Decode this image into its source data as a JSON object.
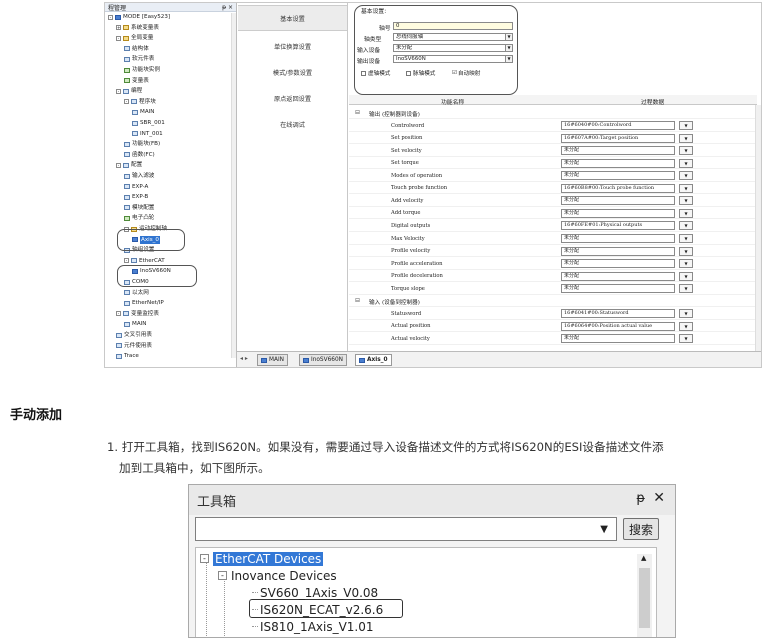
{
  "project": {
    "panel_title": "程管理",
    "panel_pin": "ᵽ ×",
    "tree": [
      {
        "label": "MODE [Easy523]",
        "depth": 0,
        "pm": "-",
        "icon": "b"
      },
      {
        "label": "系统变量表",
        "depth": 1,
        "pm": "+",
        "icon": "y"
      },
      {
        "label": "全局变量",
        "depth": 1,
        "pm": "-",
        "icon": "y"
      },
      {
        "label": "结构体",
        "depth": 2,
        "pm": "",
        "icon": ""
      },
      {
        "label": "软元件表",
        "depth": 2,
        "pm": "",
        "icon": ""
      },
      {
        "label": "功能块实例",
        "depth": 2,
        "pm": "",
        "icon": "g"
      },
      {
        "label": "变量表",
        "depth": 2,
        "pm": "",
        "icon": "g"
      },
      {
        "label": "编程",
        "depth": 1,
        "pm": "-",
        "icon": ""
      },
      {
        "label": "程序块",
        "depth": 2,
        "pm": "-",
        "icon": ""
      },
      {
        "label": "MAIN",
        "depth": 3,
        "pm": "",
        "icon": ""
      },
      {
        "label": "SBR_001",
        "depth": 3,
        "pm": "",
        "icon": ""
      },
      {
        "label": "INT_001",
        "depth": 3,
        "pm": "",
        "icon": ""
      },
      {
        "label": "功能块(FB)",
        "depth": 2,
        "pm": "",
        "icon": ""
      },
      {
        "label": "函数(FC)",
        "depth": 2,
        "pm": "",
        "icon": ""
      },
      {
        "label": "配置",
        "depth": 1,
        "pm": "-",
        "icon": ""
      },
      {
        "label": "输入滤波",
        "depth": 2,
        "pm": "",
        "icon": ""
      },
      {
        "label": "EXP-A",
        "depth": 2,
        "pm": "",
        "icon": ""
      },
      {
        "label": "EXP-B",
        "depth": 2,
        "pm": "",
        "icon": ""
      },
      {
        "label": "模块配置",
        "depth": 2,
        "pm": "",
        "icon": ""
      },
      {
        "label": "电子凸轮",
        "depth": 2,
        "pm": "",
        "icon": "g"
      },
      {
        "label": "运动控制轴",
        "depth": 2,
        "pm": "-",
        "icon": "y"
      },
      {
        "label": "Axis_0",
        "depth": 3,
        "pm": "",
        "icon": "b",
        "selected": true
      },
      {
        "label": "轴组设置",
        "depth": 2,
        "pm": "",
        "icon": ""
      },
      {
        "label": "EtherCAT",
        "depth": 2,
        "pm": "-",
        "icon": ""
      },
      {
        "label": "InoSV660N",
        "depth": 3,
        "pm": "",
        "icon": "b"
      },
      {
        "label": "COM0",
        "depth": 2,
        "pm": "",
        "icon": ""
      },
      {
        "label": "以太网",
        "depth": 2,
        "pm": "",
        "icon": ""
      },
      {
        "label": "EtherNet/IP",
        "depth": 2,
        "pm": "",
        "icon": ""
      },
      {
        "label": "变量监控表",
        "depth": 1,
        "pm": "-",
        "icon": ""
      },
      {
        "label": "MAIN",
        "depth": 2,
        "pm": "",
        "icon": ""
      },
      {
        "label": "交叉引用表",
        "depth": 1,
        "pm": "",
        "icon": ""
      },
      {
        "label": "元件使用表",
        "depth": 1,
        "pm": "",
        "icon": ""
      },
      {
        "label": "Trace",
        "depth": 1,
        "pm": "",
        "icon": ""
      }
    ]
  },
  "tabs": [
    {
      "label": "MAIN",
      "active": false
    },
    {
      "label": "InoSV660N",
      "active": false
    },
    {
      "label": "Axis_0",
      "active": true
    }
  ],
  "tab_nav": "◂ ▸",
  "left_nav": [
    "基本设置",
    "单位换算设置",
    "模式/参数设置",
    "原点返回设置",
    "在线调试"
  ],
  "basic": {
    "group_title": "基本设置:",
    "axis_no_label": "轴号",
    "axis_no_value": "0",
    "axis_type_label": "轴类型",
    "axis_type_value": "总线伺服轴",
    "input_dev_label": "输入设备",
    "input_dev_value": "未分配",
    "output_dev_label": "输出设备",
    "output_dev_value": "InoSV660N",
    "virtual_mode": "虚轴模式",
    "pulse_mode": "脉轴模式",
    "auto_map": "自动映射",
    "auto_map_checked": "☑"
  },
  "param_table": {
    "col_func": "功能名称",
    "col_data": "过程数据",
    "rows": [
      {
        "group": true,
        "name": "输出 (控制器到设备)"
      },
      {
        "name": "Controlword",
        "value": "16#6040#00:Controlword"
      },
      {
        "name": "Set position",
        "value": "16#607A#00:Target position"
      },
      {
        "name": "Set velocity",
        "value": "未分配"
      },
      {
        "name": "Set torque",
        "value": "未分配"
      },
      {
        "name": "Modes of operation",
        "value": "未分配"
      },
      {
        "name": "Touch probe function",
        "value": "16#60B8#00:Touch probe function"
      },
      {
        "name": "Add velocity",
        "value": "未分配"
      },
      {
        "name": "Add torque",
        "value": "未分配"
      },
      {
        "name": "Digital outputs",
        "value": "16#60FE#01:Physical outputs"
      },
      {
        "name": "Max Velocity",
        "value": "未分配"
      },
      {
        "name": "Profile velocity",
        "value": "未分配"
      },
      {
        "name": "Profile acceleration",
        "value": "未分配"
      },
      {
        "name": "Profile deceleration",
        "value": "未分配"
      },
      {
        "name": "Torque slope",
        "value": "未分配"
      },
      {
        "group": true,
        "name": "输入 (设备到控制器)"
      },
      {
        "name": "Statusword",
        "value": "16#6041#00:Statusword"
      },
      {
        "name": "Actual position",
        "value": "16#6064#00:Position actual value"
      },
      {
        "name": "Actual velocity",
        "value": "未分配"
      }
    ]
  },
  "doc": {
    "heading": "手动添加",
    "step1_line1": "1. 打开工具箱，找到IS620N。如果没有，需要通过导入设备描述文件的方式将IS620N的ESI设备描述文件添",
    "step1_line2": "加到工具箱中，如下图所示。"
  },
  "toolbox": {
    "title": "工具箱",
    "pin": "ᵽ",
    "close": "✕",
    "search_button": "搜索",
    "tree": [
      {
        "label": "EtherCAT Devices",
        "pm": "-",
        "selected": true
      },
      {
        "label": "Inovance Devices",
        "pm": "-"
      },
      {
        "label": "SV660_1Axis_V0.08",
        "pm": ""
      },
      {
        "label": "IS620N_ECAT_v2.6.6",
        "pm": ""
      },
      {
        "label": "IS810_1Axis_V1.01",
        "pm": ""
      }
    ]
  }
}
